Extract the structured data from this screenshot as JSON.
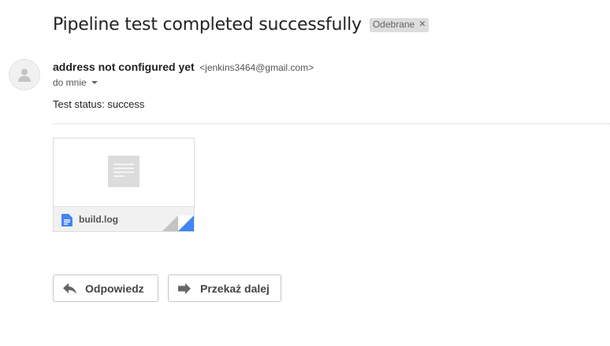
{
  "message": {
    "subject": "Pipeline test completed successfully",
    "label": "Odebrane",
    "sender_name": "address not configured yet",
    "sender_email": "<jenkins3464@gmail.com>",
    "recipient": "do mnie",
    "body": "Test status: success"
  },
  "attachment": {
    "file_name": "build.log",
    "icon": "document-icon",
    "icon_color": "#4285f4"
  },
  "actions": {
    "reply_label": "Odpowiedz",
    "forward_label": "Przekaż dalej"
  },
  "colors": {
    "accent": "#4285f4",
    "label_chip_bg": "#dddddd"
  }
}
